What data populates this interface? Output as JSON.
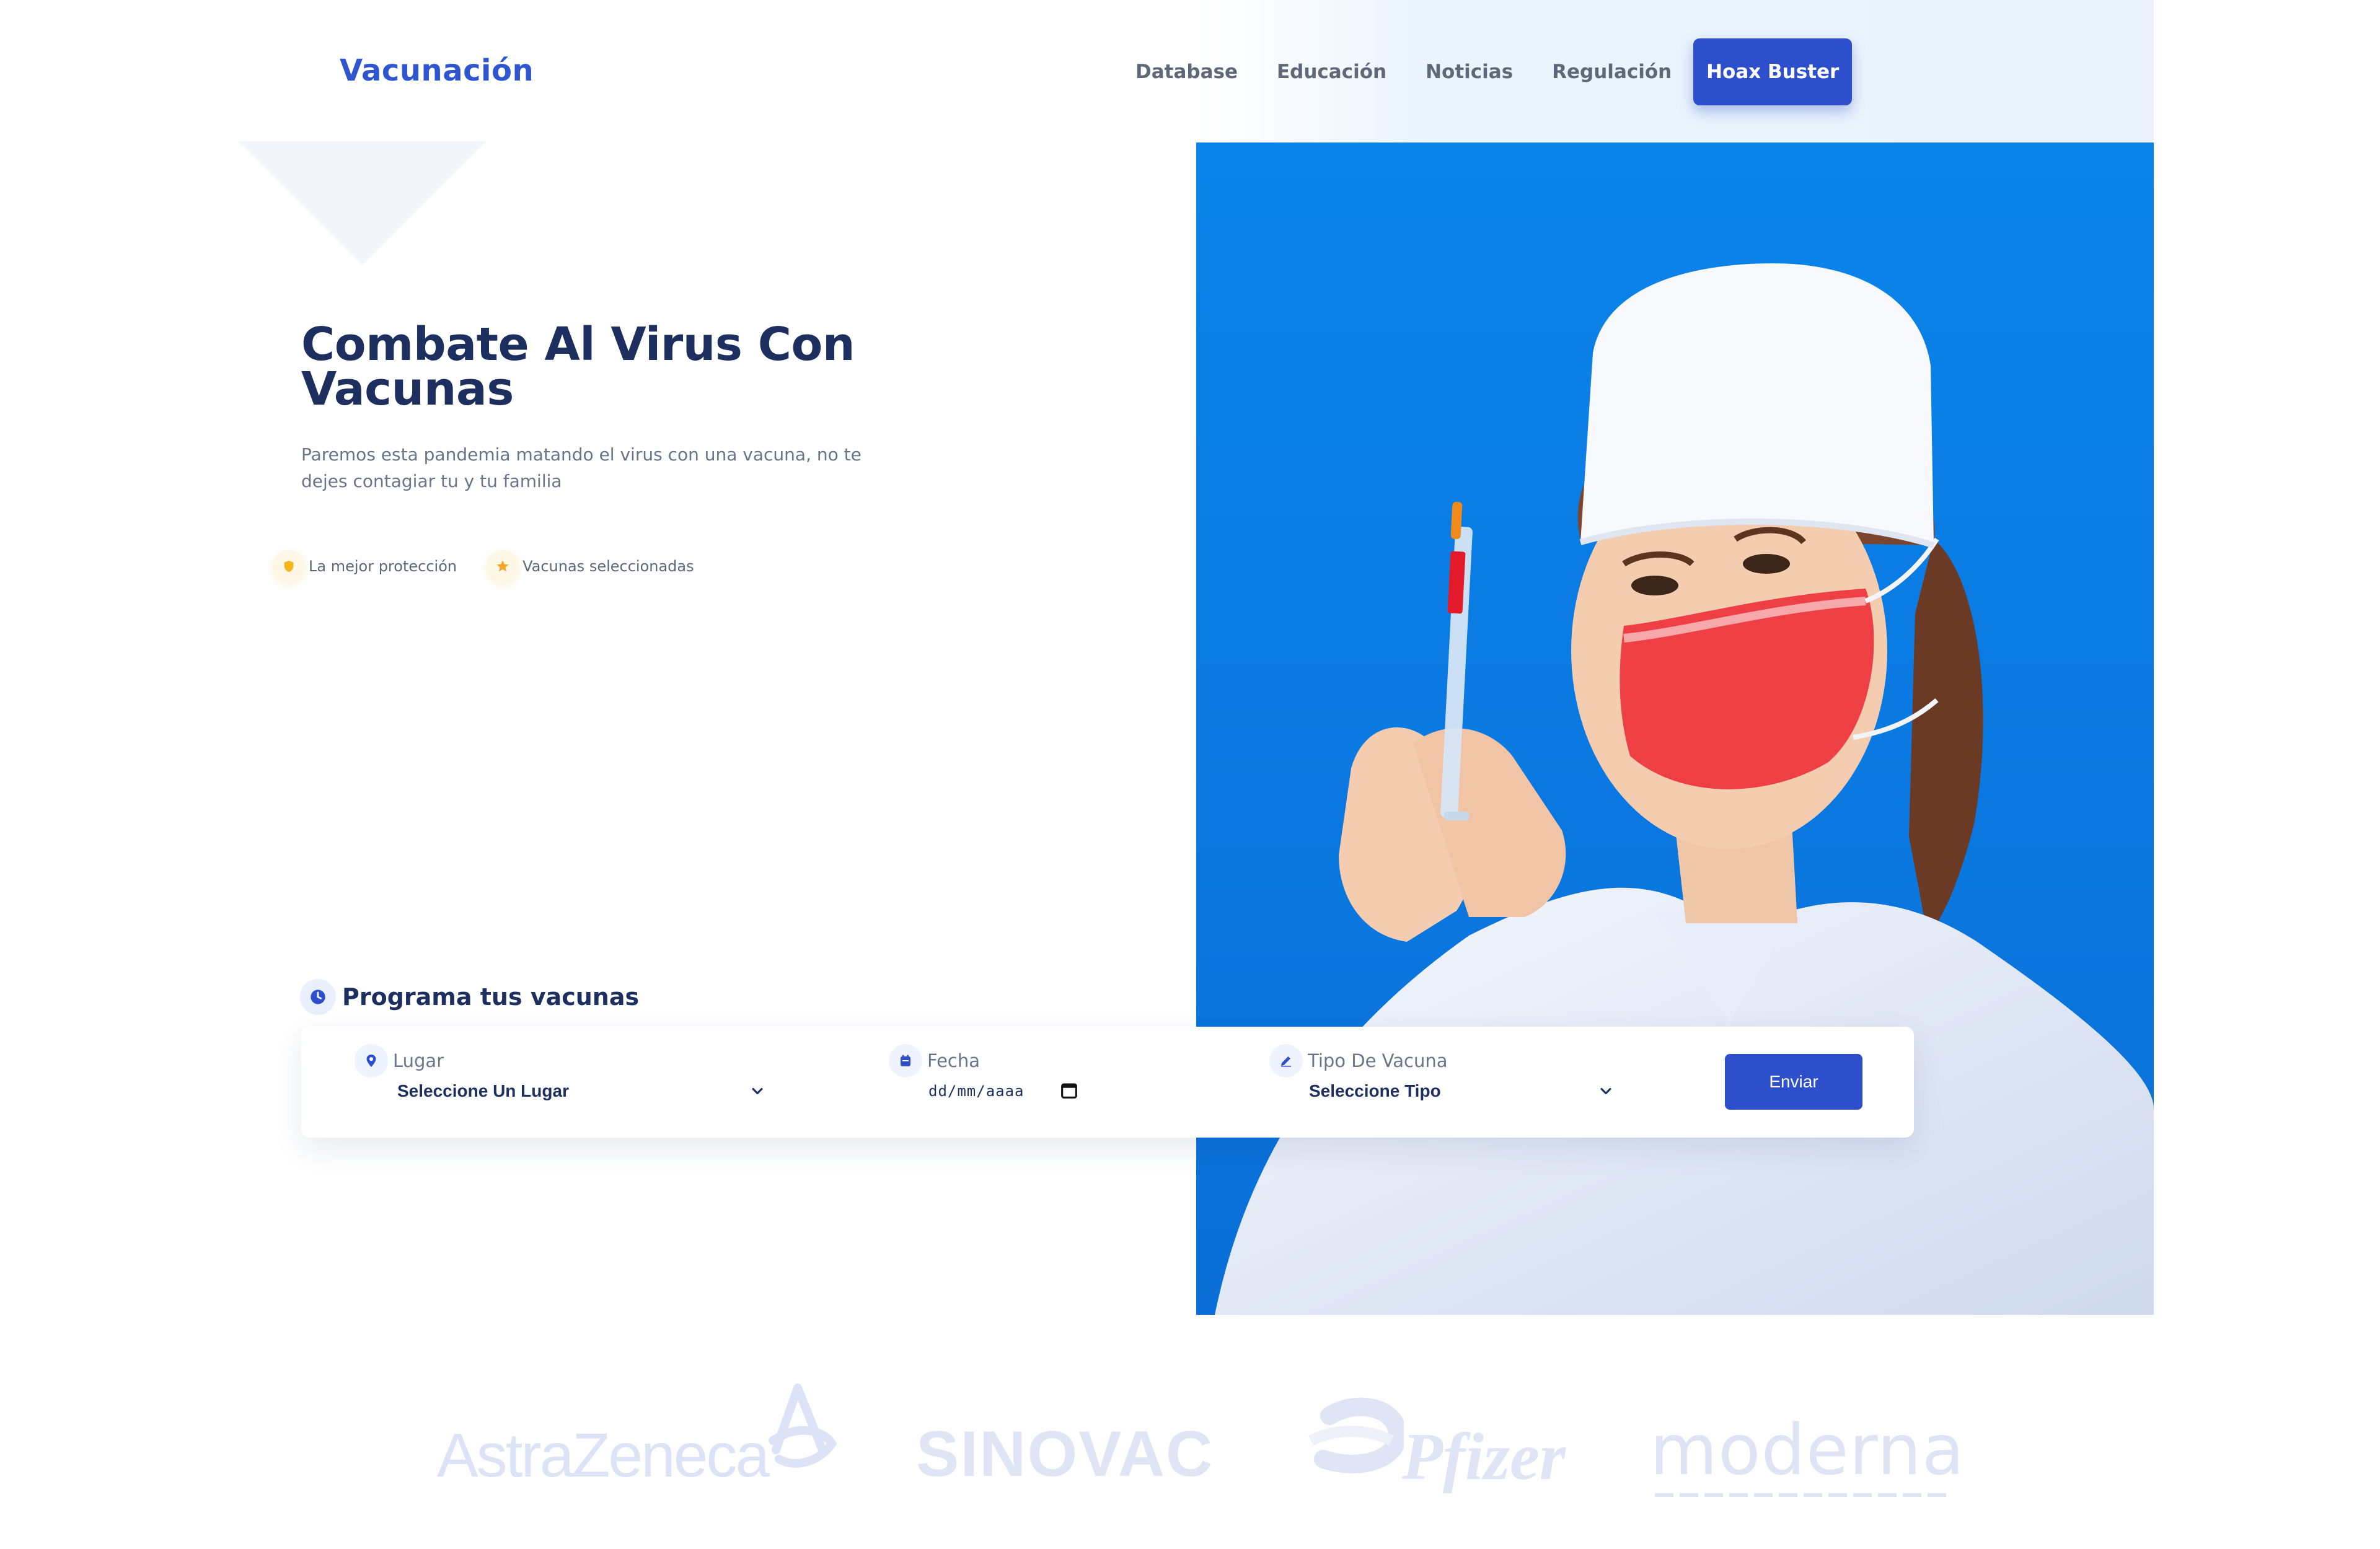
{
  "header": {
    "logo": "Vacunación",
    "nav": [
      "Database",
      "Educación",
      "Noticias",
      "Regulación"
    ],
    "cta": "Hoax Buster"
  },
  "hero": {
    "title_line1": "Combate Al Virus Con",
    "title_line2": "Vacunas",
    "subtitle_line1": "Paremos esta pandemia matando el virus con una vacuna, no te",
    "subtitle_line2": "dejes contagiar tu y tu familia",
    "features": [
      {
        "icon": "shield-icon",
        "label": "La mejor protección"
      },
      {
        "icon": "star-icon",
        "label": "Vacunas seleccionadas"
      }
    ]
  },
  "schedule": {
    "title": "Programa tus vacunas",
    "place": {
      "label": "Lugar",
      "value": "Seleccione Un Lugar",
      "icon": "location-pin-icon"
    },
    "date": {
      "label": "Fecha",
      "value": "dd/mm/aaaa",
      "icon": "calendar-icon"
    },
    "type": {
      "label": "Tipo De Vacuna",
      "value": "Seleccione Tipo",
      "icon": "pencil-icon"
    },
    "submit": "Enviar"
  },
  "brands": [
    "AstraZeneca",
    "SINOVAC",
    "Pfizer",
    "moderna"
  ],
  "colors": {
    "primary": "#2e4fcc",
    "logo": "#2f56d0",
    "heading": "#1d2f5e",
    "body_text": "#6b7488",
    "photo_bg": "#0a7ee6"
  }
}
